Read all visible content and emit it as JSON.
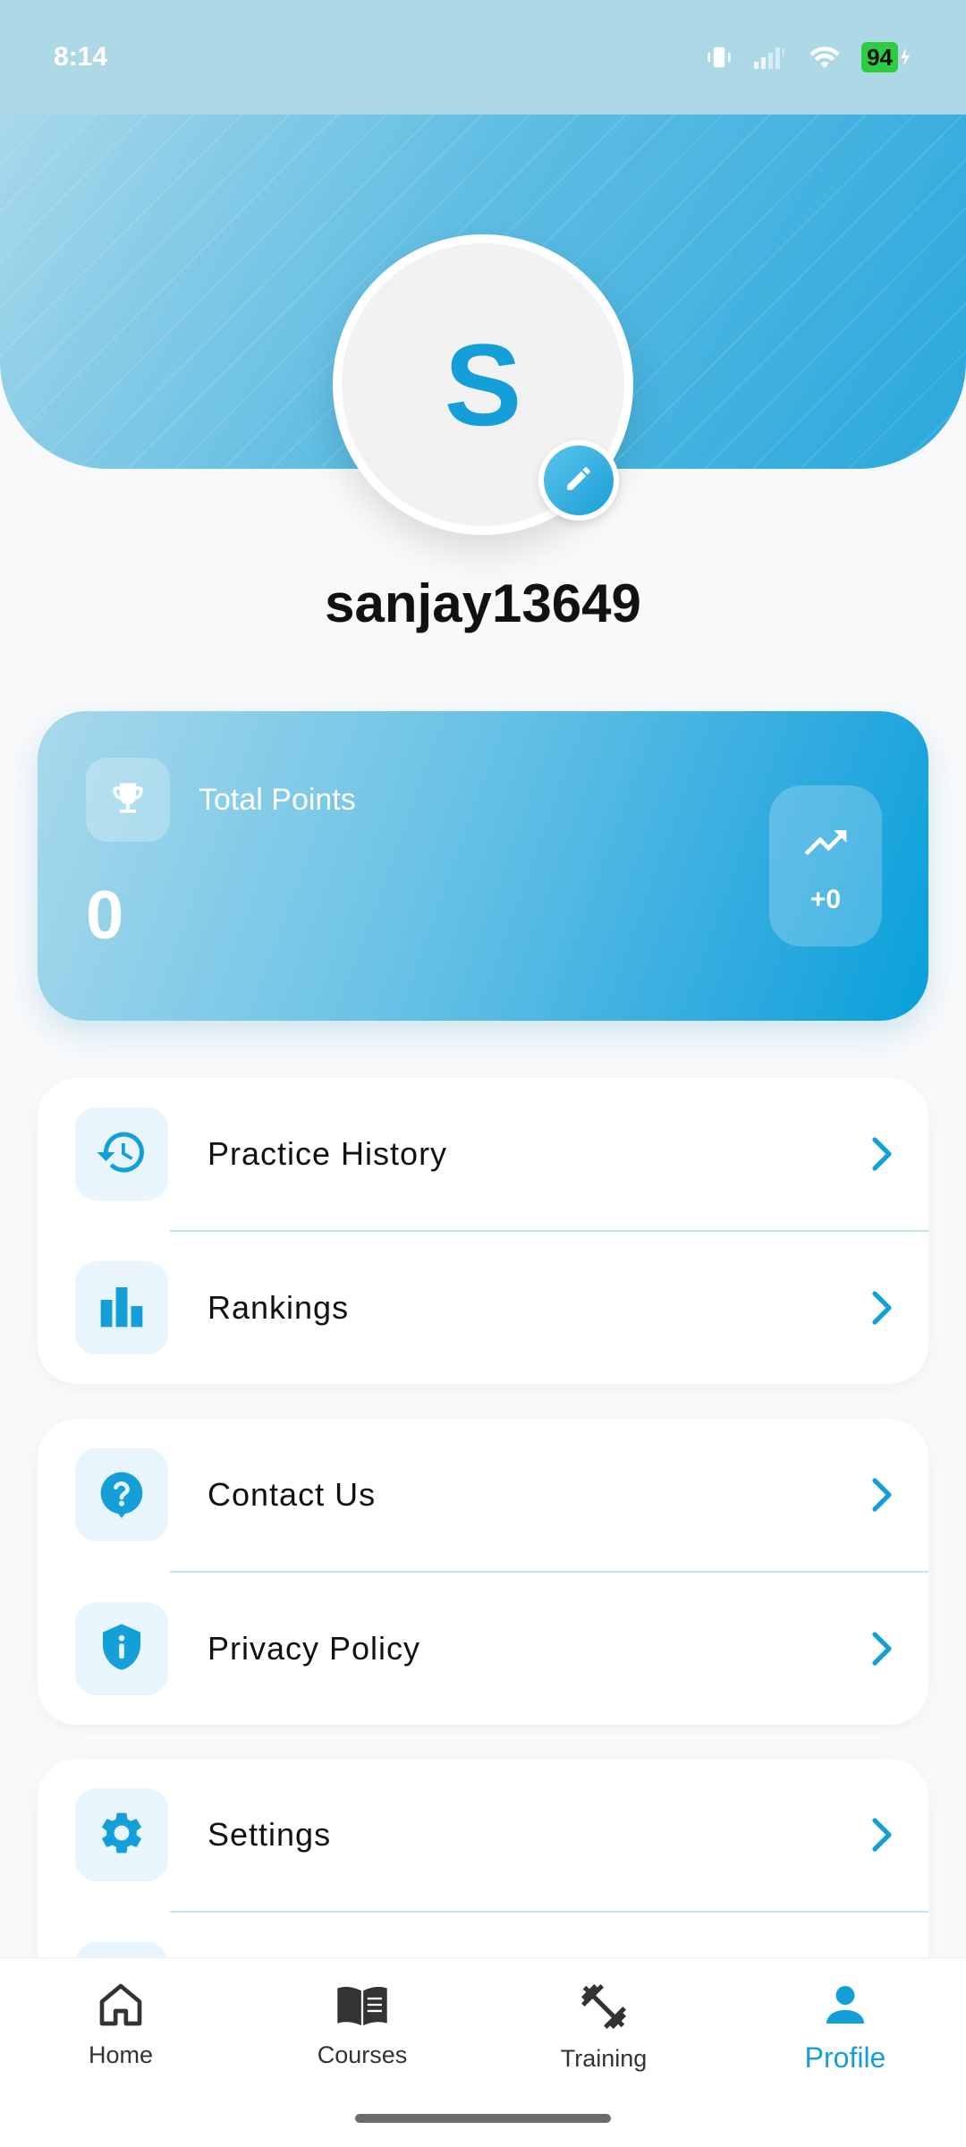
{
  "status_bar": {
    "time": "8:14",
    "battery": "94",
    "icons": [
      "vibrate-icon",
      "signal-icon",
      "wifi-icon",
      "battery-icon",
      "charging-icon"
    ]
  },
  "profile": {
    "avatar_initial": "S",
    "username": "sanjay13649"
  },
  "points_card": {
    "label": "Total Points",
    "value": "0",
    "trend": "+0",
    "icons": [
      "trophy-icon",
      "trending-up-icon"
    ]
  },
  "menu_groups": [
    [
      {
        "label": "Practice History",
        "icon": "history-icon"
      },
      {
        "label": "Rankings",
        "icon": "bar-chart-icon"
      }
    ],
    [
      {
        "label": "Contact Us",
        "icon": "help-icon"
      },
      {
        "label": "Privacy Policy",
        "icon": "shield-info-icon"
      }
    ],
    [
      {
        "label": "Settings",
        "icon": "gear-icon"
      },
      {
        "label": "",
        "icon": "partially-hidden-icon"
      }
    ]
  ],
  "bottom_nav": {
    "items": [
      {
        "label": "Home",
        "icon": "home-icon",
        "active": false
      },
      {
        "label": "Courses",
        "icon": "book-icon",
        "active": false
      },
      {
        "label": "Training",
        "icon": "dumbbell-icon",
        "active": false
      },
      {
        "label": "Profile",
        "icon": "person-icon",
        "active": true
      }
    ]
  },
  "colors": {
    "accent": "#149fd8",
    "header_start": "#a8d8ea",
    "header_end": "#2aa8dc",
    "status_bar": "#add8e6",
    "icon_bg": "#e8f5fc",
    "divider": "#bfe5f3"
  }
}
